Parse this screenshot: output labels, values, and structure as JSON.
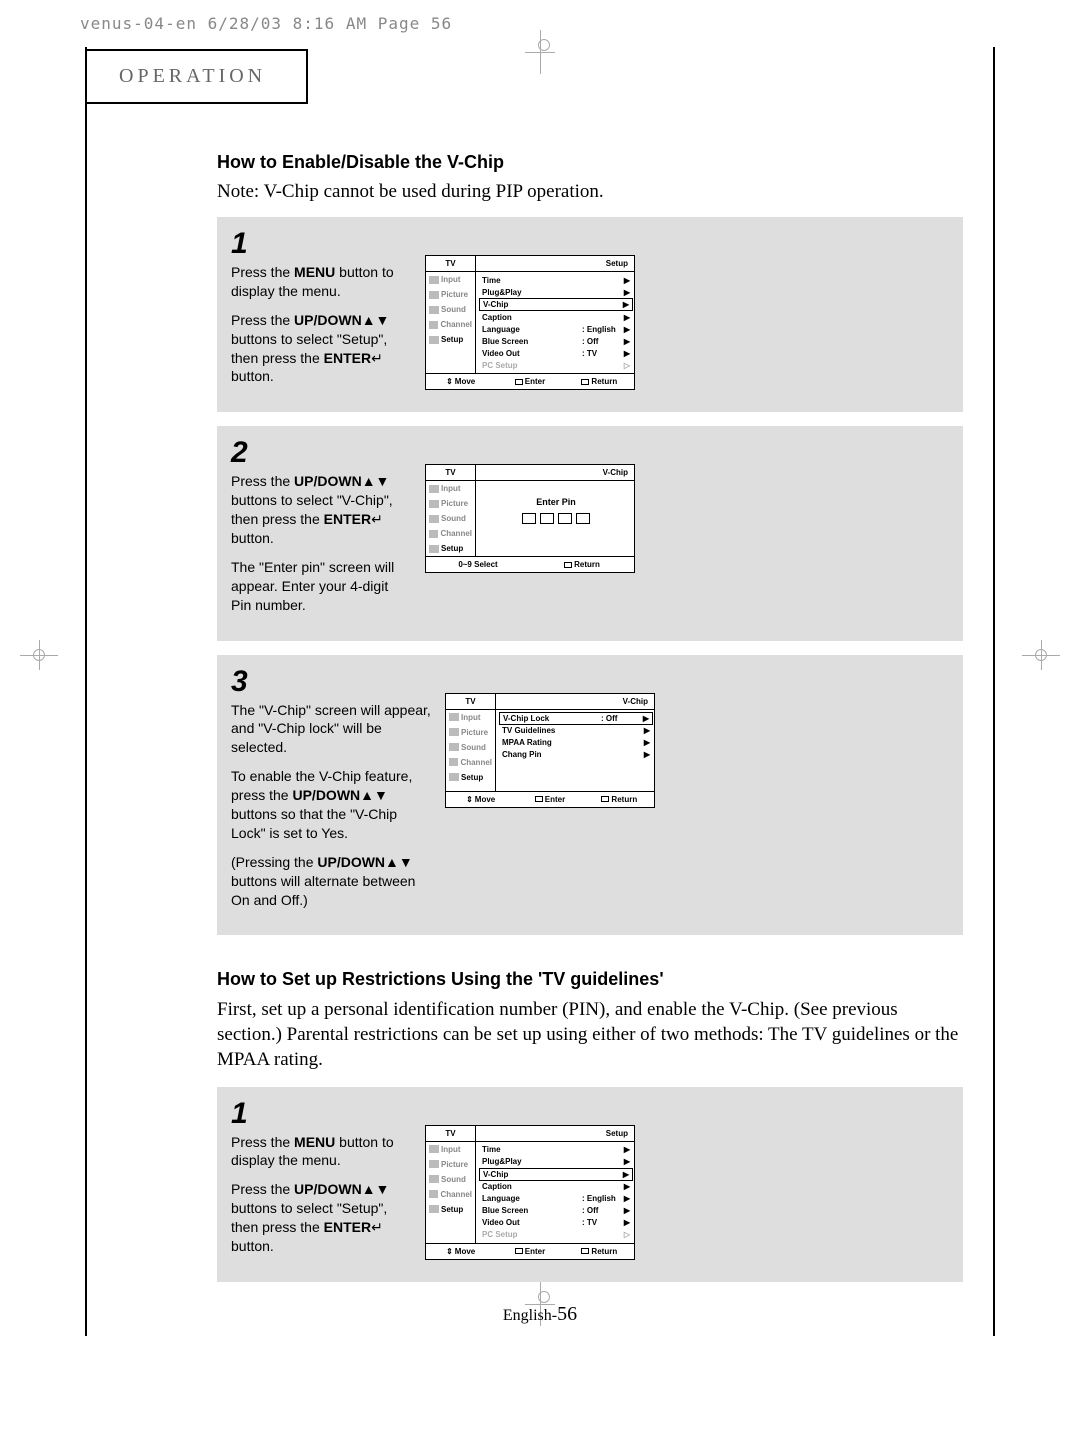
{
  "header": "venus-04-en  6/28/03  8:16 AM  Page 56",
  "section_label": "OPERATION",
  "subhead1": "How to Enable/Disable the V-Chip",
  "note1": "Note: V-Chip cannot be used during PIP operation.",
  "steps_a": {
    "s1": {
      "num": "1",
      "p1a": "Press the ",
      "p1b": "MENU",
      "p1c": " button to display the menu.",
      "p2a": "Press the ",
      "p2b": "UP/DOWN",
      "p2c": " buttons to select \"Setup\", then press the ",
      "p2d": "ENTER",
      "p2e": " button."
    },
    "s2": {
      "num": "2",
      "p1a": "Press the ",
      "p1b": "UP/DOWN",
      "p1c": " buttons to select \"V-Chip\", then press the ",
      "p1d": "ENTER",
      "p1e": "  button.",
      "p2": "The \"Enter pin\" screen will appear. Enter your 4-digit Pin number."
    },
    "s3": {
      "num": "3",
      "p1": "The \"V-Chip\" screen will appear, and \"V-Chip lock\" will be selected.",
      "p2a": "To enable the V-Chip feature, press the ",
      "p2b": "UP/DOWN",
      "p2c": " buttons so that the \"V-Chip Lock\" is set to Yes.",
      "p3a": "(Pressing the ",
      "p3b": "UP/DOWN",
      "p3c": " buttons will alternate between On and Off.)"
    }
  },
  "subhead2": "How to Set up Restrictions Using the 'TV guidelines'",
  "intro2": "First, set up a personal identification number (PIN), and enable the V-Chip. (See previous section.) Parental restrictions can be set up using either of two methods: The TV guidelines or the MPAA rating.",
  "steps_b": {
    "s1": {
      "num": "1",
      "p1a": "Press the ",
      "p1b": "MENU",
      "p1c": " button to display the menu.",
      "p2a": "Press the ",
      "p2b": "UP/DOWN",
      "p2c": " buttons to select \"Setup\", then press the ",
      "p2d": "ENTER",
      "p2e": " button."
    }
  },
  "osd": {
    "tv": "TV",
    "setup": "Setup",
    "vchip": "V-Chip",
    "tabs": {
      "input": "Input",
      "picture": "Picture",
      "sound": "Sound",
      "channel": "Channel",
      "setup_tab": "Setup"
    },
    "menu_setup": {
      "time": "Time",
      "plugplay": "Plug&Play",
      "vchip": "V-Chip",
      "caption": "Caption",
      "language": "Language",
      "language_v": ": English",
      "bluescreen": "Blue Screen",
      "bluescreen_v": ": Off",
      "videoout": "Video Out",
      "videoout_v": ": TV",
      "pcsetup": "PC Setup"
    },
    "menu_vchip": {
      "lock": "V-Chip Lock",
      "lock_v": ": Off",
      "tvg": "TV Guidelines",
      "mpaa": "MPAA Rating",
      "chang": "Chang Pin"
    },
    "enterpin": "Enter Pin",
    "foot": {
      "move": "Move",
      "enter": "Enter",
      "return": "Return",
      "select": "0~9 Select"
    }
  },
  "glyphs": {
    "ud": "▲▼",
    "enter": "↵",
    "arrow": "▶",
    "darrow": "▷",
    "updown_icon": "⇕"
  },
  "footer": {
    "lang": "English-",
    "num": "56"
  }
}
